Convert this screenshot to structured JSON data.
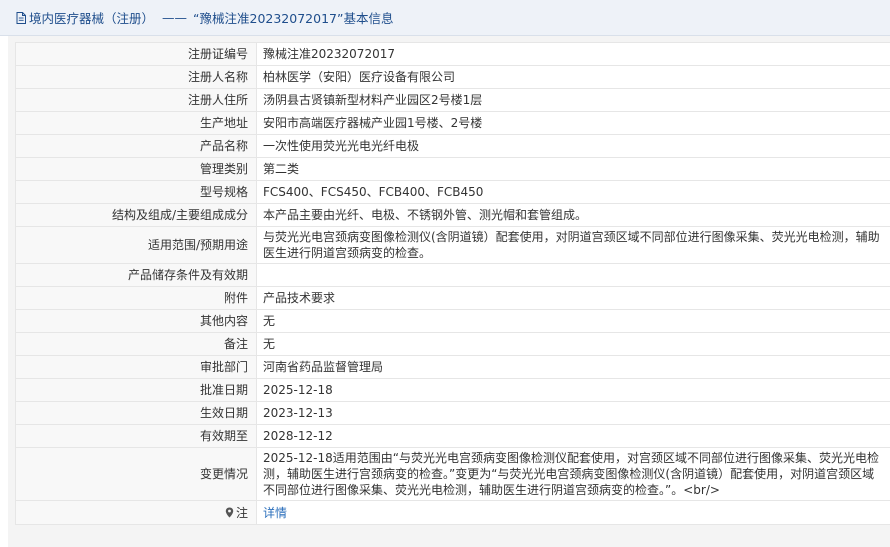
{
  "header": {
    "category_link": "境内医疗器械（注册）",
    "separator": "——",
    "record_title": "“豫械注准20232072017”基本信息"
  },
  "rows": [
    {
      "label": "注册证编号",
      "value": "豫械注准20232072017"
    },
    {
      "label": "注册人名称",
      "value": "柏林医学（安阳）医疗设备有限公司"
    },
    {
      "label": "注册人住所",
      "value": "汤阴县古贤镇新型材料产业园区2号楼1层"
    },
    {
      "label": "生产地址",
      "value": "安阳市高端医疗器械产业园1号楼、2号楼"
    },
    {
      "label": "产品名称",
      "value": "一次性使用荧光光电光纤电极"
    },
    {
      "label": "管理类别",
      "value": "第二类"
    },
    {
      "label": "型号规格",
      "value": "FCS400、FCS450、FCB400、FCB450"
    },
    {
      "label": "结构及组成/主要组成成分",
      "value": "本产品主要由光纤、电极、不锈钢外管、测光帽和套管组成。"
    },
    {
      "label": "适用范围/预期用途",
      "value": "与荧光光电宫颈病变图像检测仪(含阴道镜）配套使用，对阴道宫颈区域不同部位进行图像采集、荧光光电检测，辅助医生进行阴道宫颈病变的检查。"
    },
    {
      "label": "产品储存条件及有效期",
      "value": ""
    },
    {
      "label": "附件",
      "value": "产品技术要求"
    },
    {
      "label": "其他内容",
      "value": "无"
    },
    {
      "label": "备注",
      "value": "无"
    },
    {
      "label": "审批部门",
      "value": "河南省药品监督管理局"
    },
    {
      "label": "批准日期",
      "value": "2025-12-18"
    },
    {
      "label": "生效日期",
      "value": "2023-12-13"
    },
    {
      "label": "有效期至",
      "value": "2028-12-12"
    },
    {
      "label": "变更情况",
      "value": "2025-12-18适用范围由“与荧光光电宫颈病变图像检测仪配套使用，对宫颈区域不同部位进行图像采集、荧光光电检测，辅助医生进行宫颈病变的检查。”变更为“与荧光光电宫颈病变图像检测仪(含阴道镜）配套使用，对阴道宫颈区域不同部位进行图像采集、荧光光电检测，辅助医生进行阴道宫颈病变的检查。”。<br/>"
    }
  ],
  "note_row": {
    "label": "注",
    "link": "详情"
  },
  "icons": {
    "title": "document-icon",
    "note": "location-pin-icon"
  },
  "colors": {
    "title_text": "#1f4e8c",
    "title_bg": "#eef2f8",
    "link": "#2a6ebb"
  }
}
